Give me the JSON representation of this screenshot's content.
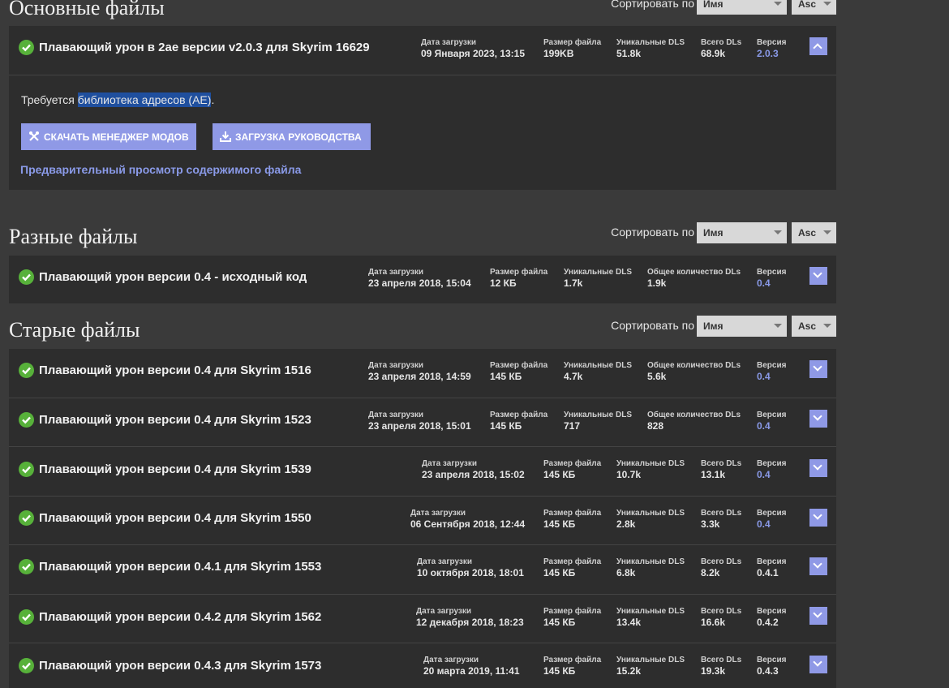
{
  "sort": {
    "label": "Сортировать по",
    "field": "Имя",
    "direction": "Asc"
  },
  "sections": {
    "main": {
      "title": "Основные файлы",
      "file": {
        "name": "Плавающий урон в 2ае версии v2.0.3 для Skyrim 16629",
        "date_label": "Дата загрузки",
        "date": "09 Января 2023, 13:15",
        "size_label": "Размер файла",
        "size": "199KB",
        "unique_label": "Уникальные DLS",
        "unique": "51.8k",
        "total_label": "Всего DLs",
        "total": "68.9k",
        "version_label": "Версия",
        "version": "2.0.3"
      },
      "requires_text": "Требуется ",
      "requires_link": "библиотека адресов (AE)",
      "requires_end": ".",
      "btn_manager": "СКАЧАТЬ МЕНЕДЖЕР МОДОВ",
      "btn_manual": "ЗАГРУЗКА РУКОВОДСТВА",
      "preview_link": "Предварительный просмотр содержимого файла"
    },
    "misc": {
      "title": "Разные файлы",
      "file": {
        "name": "Плавающий урон версии 0.4 - исходный код",
        "date_label": "Дата загрузки",
        "date": "23 апреля 2018, 15:04",
        "size_label": "Размер файла",
        "size": "12 КБ",
        "unique_label": "Уникальные DLS",
        "unique": "1.7k",
        "total_label": "Общее количество DLs",
        "total": "1.9k",
        "version_label": "Версия",
        "version": "0.4"
      }
    },
    "old": {
      "title": "Старые файлы",
      "files": [
        {
          "name": "Плавающий урон версии 0.4 для Skyrim 1516",
          "date_label": "Дата загрузки",
          "date": "23 апреля 2018, 14:59",
          "size_label": "Размер файла",
          "size": "145 КБ",
          "unique_label": "Уникальные DLS",
          "unique": "4.7k",
          "total_label": "Общее количество DLs",
          "total": "5.6k",
          "version_label": "Версия",
          "version": "0.4"
        },
        {
          "name": "Плавающий урон версии 0.4 для Skyrim 1523",
          "date_label": "Дата загрузки",
          "date": "23 апреля 2018, 15:01",
          "size_label": "Размер файла",
          "size": "145 КБ",
          "unique_label": "Уникальные DLS",
          "unique": "717",
          "total_label": "Общее количество DLs",
          "total": "828",
          "version_label": "Версия",
          "version": "0.4"
        },
        {
          "name": "Плавающий урон версии 0.4 для Skyrim 1539",
          "date_label": "Дата загрузки",
          "date": "23 апреля 2018, 15:02",
          "size_label": "Размер файла",
          "size": "145 КБ",
          "unique_label": "Уникальные DLS",
          "unique": "10.7k",
          "total_label": "Всего DLs",
          "total": "13.1k",
          "version_label": "Версия",
          "version": "0.4"
        },
        {
          "name": "Плавающий урон версии 0.4 для Skyrim 1550",
          "date_label": "Дата загрузки",
          "date": "06 Сентября 2018, 12:44",
          "size_label": "Размер файла",
          "size": "145 КБ",
          "unique_label": "Уникальные DLS",
          "unique": "2.8k",
          "total_label": "Всего DLs",
          "total": "3.3k",
          "version_label": "Версия",
          "version": "0.4"
        },
        {
          "name": "Плавающий урон версии 0.4.1 для Skyrim 1553",
          "date_label": "Дата загрузки",
          "date": "10 октября 2018, 18:01",
          "size_label": "Размер файла",
          "size": "145 КБ",
          "unique_label": "Уникальные DLS",
          "unique": "6.8k",
          "total_label": "Всего DLs",
          "total": "8.2k",
          "version_label": "Версия",
          "version": "0.4.1"
        },
        {
          "name": "Плавающий урон версии 0.4.2 для Skyrim 1562",
          "date_label": "Дата загрузки",
          "date": "12 декабря 2018, 18:23",
          "size_label": "Размер файла",
          "size": "145 КБ",
          "unique_label": "Уникальные DLS",
          "unique": "13.4k",
          "total_label": "Всего DLs",
          "total": "16.6k",
          "version_label": "Версия",
          "version": "0.4.2"
        },
        {
          "name": "Плавающий урон версии 0.4.3 для Skyrim 1573",
          "date_label": "Дата загрузки",
          "date": "20 марта 2019, 11:41",
          "size_label": "Размер файла",
          "size": "145 КБ",
          "unique_label": "Уникальные DLS",
          "unique": "15.2k",
          "total_label": "Всего DLs",
          "total": "19.3k",
          "version_label": "Версия",
          "version": "0.4.3"
        }
      ]
    }
  }
}
